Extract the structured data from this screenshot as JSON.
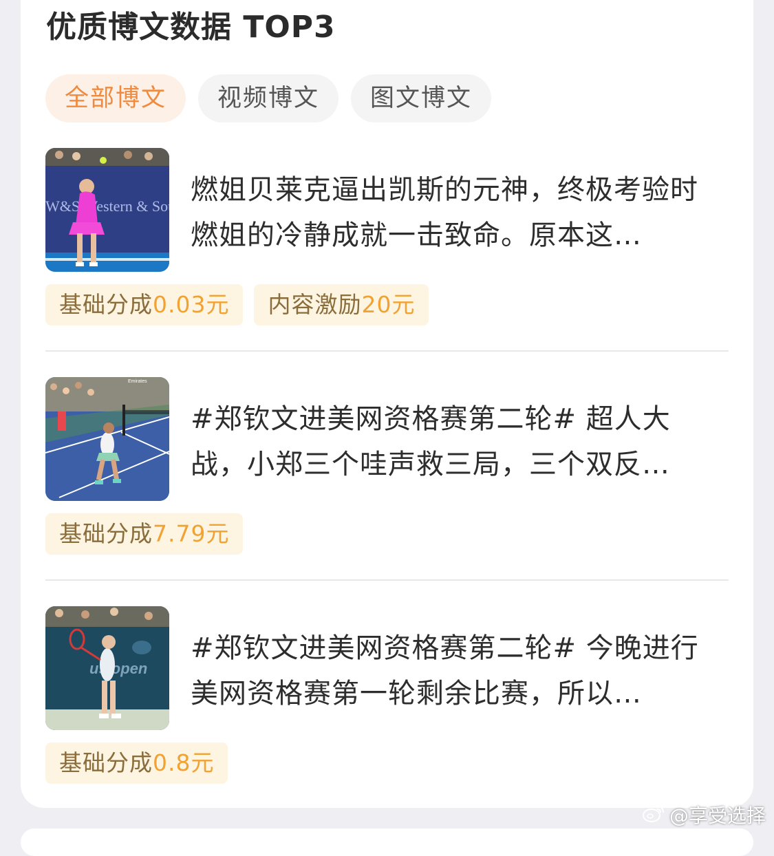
{
  "section": {
    "title": "优质博文数据 TOP3"
  },
  "tabs": [
    {
      "label": "全部博文",
      "active": true
    },
    {
      "label": "视频博文",
      "active": false
    },
    {
      "label": "图文博文",
      "active": false
    }
  ],
  "posts": [
    {
      "text": "燃姐贝莱克逼出凯斯的元神，终极考验时燃姐的冷静成就一击致命。原本这…",
      "thumbnail_icon": "tennis-player-thumbnail",
      "thumbnail_caption": "W&S  Western & Southern Financial Group",
      "tags": [
        {
          "label": "基础分成",
          "amount": "0.03元"
        },
        {
          "label": "内容激励",
          "amount": "20元"
        }
      ]
    },
    {
      "text": "#郑钦文进美网资格赛第二轮# 超人大战，小郑三个哇声救三局，三个双反…",
      "thumbnail_icon": "tennis-court-thumbnail",
      "thumbnail_caption": "Emirates",
      "tags": [
        {
          "label": "基础分成",
          "amount": "7.79元"
        }
      ]
    },
    {
      "text": "#郑钦文进美网资格赛第二轮# 今晚进行美网资格赛第一轮剩余比赛，所以…",
      "thumbnail_icon": "tennis-player-thumbnail",
      "thumbnail_caption": "us open",
      "tags": [
        {
          "label": "基础分成",
          "amount": "0.8元"
        }
      ]
    }
  ],
  "watermark": {
    "text": "@享受选择",
    "icon": "weibo-icon"
  },
  "colors": {
    "accent": "#f08a3e",
    "tag_bg": "#fdf4e2",
    "tag_amount": "#f0a232",
    "tab_active_bg": "#fdf0e6",
    "page_bg": "#efeff3"
  }
}
